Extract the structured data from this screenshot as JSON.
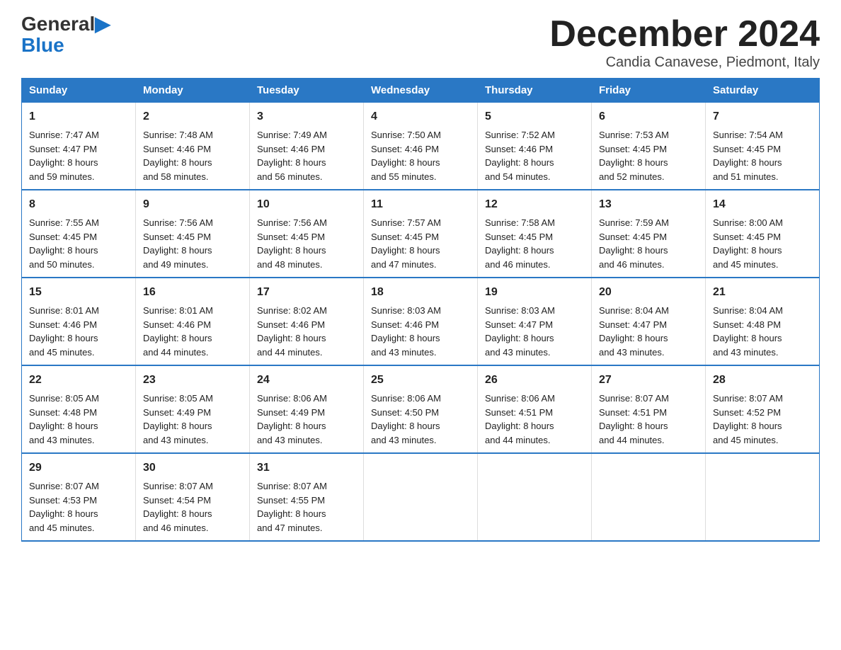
{
  "header": {
    "logo_general": "General",
    "logo_blue": "Blue",
    "month_title": "December 2024",
    "location": "Candia Canavese, Piedmont, Italy"
  },
  "weekdays": [
    "Sunday",
    "Monday",
    "Tuesday",
    "Wednesday",
    "Thursday",
    "Friday",
    "Saturday"
  ],
  "weeks": [
    [
      {
        "day": "1",
        "sunrise": "7:47 AM",
        "sunset": "4:47 PM",
        "daylight": "8 hours and 59 minutes."
      },
      {
        "day": "2",
        "sunrise": "7:48 AM",
        "sunset": "4:46 PM",
        "daylight": "8 hours and 58 minutes."
      },
      {
        "day": "3",
        "sunrise": "7:49 AM",
        "sunset": "4:46 PM",
        "daylight": "8 hours and 56 minutes."
      },
      {
        "day": "4",
        "sunrise": "7:50 AM",
        "sunset": "4:46 PM",
        "daylight": "8 hours and 55 minutes."
      },
      {
        "day": "5",
        "sunrise": "7:52 AM",
        "sunset": "4:46 PM",
        "daylight": "8 hours and 54 minutes."
      },
      {
        "day": "6",
        "sunrise": "7:53 AM",
        "sunset": "4:45 PM",
        "daylight": "8 hours and 52 minutes."
      },
      {
        "day": "7",
        "sunrise": "7:54 AM",
        "sunset": "4:45 PM",
        "daylight": "8 hours and 51 minutes."
      }
    ],
    [
      {
        "day": "8",
        "sunrise": "7:55 AM",
        "sunset": "4:45 PM",
        "daylight": "8 hours and 50 minutes."
      },
      {
        "day": "9",
        "sunrise": "7:56 AM",
        "sunset": "4:45 PM",
        "daylight": "8 hours and 49 minutes."
      },
      {
        "day": "10",
        "sunrise": "7:56 AM",
        "sunset": "4:45 PM",
        "daylight": "8 hours and 48 minutes."
      },
      {
        "day": "11",
        "sunrise": "7:57 AM",
        "sunset": "4:45 PM",
        "daylight": "8 hours and 47 minutes."
      },
      {
        "day": "12",
        "sunrise": "7:58 AM",
        "sunset": "4:45 PM",
        "daylight": "8 hours and 46 minutes."
      },
      {
        "day": "13",
        "sunrise": "7:59 AM",
        "sunset": "4:45 PM",
        "daylight": "8 hours and 46 minutes."
      },
      {
        "day": "14",
        "sunrise": "8:00 AM",
        "sunset": "4:45 PM",
        "daylight": "8 hours and 45 minutes."
      }
    ],
    [
      {
        "day": "15",
        "sunrise": "8:01 AM",
        "sunset": "4:46 PM",
        "daylight": "8 hours and 45 minutes."
      },
      {
        "day": "16",
        "sunrise": "8:01 AM",
        "sunset": "4:46 PM",
        "daylight": "8 hours and 44 minutes."
      },
      {
        "day": "17",
        "sunrise": "8:02 AM",
        "sunset": "4:46 PM",
        "daylight": "8 hours and 44 minutes."
      },
      {
        "day": "18",
        "sunrise": "8:03 AM",
        "sunset": "4:46 PM",
        "daylight": "8 hours and 43 minutes."
      },
      {
        "day": "19",
        "sunrise": "8:03 AM",
        "sunset": "4:47 PM",
        "daylight": "8 hours and 43 minutes."
      },
      {
        "day": "20",
        "sunrise": "8:04 AM",
        "sunset": "4:47 PM",
        "daylight": "8 hours and 43 minutes."
      },
      {
        "day": "21",
        "sunrise": "8:04 AM",
        "sunset": "4:48 PM",
        "daylight": "8 hours and 43 minutes."
      }
    ],
    [
      {
        "day": "22",
        "sunrise": "8:05 AM",
        "sunset": "4:48 PM",
        "daylight": "8 hours and 43 minutes."
      },
      {
        "day": "23",
        "sunrise": "8:05 AM",
        "sunset": "4:49 PM",
        "daylight": "8 hours and 43 minutes."
      },
      {
        "day": "24",
        "sunrise": "8:06 AM",
        "sunset": "4:49 PM",
        "daylight": "8 hours and 43 minutes."
      },
      {
        "day": "25",
        "sunrise": "8:06 AM",
        "sunset": "4:50 PM",
        "daylight": "8 hours and 43 minutes."
      },
      {
        "day": "26",
        "sunrise": "8:06 AM",
        "sunset": "4:51 PM",
        "daylight": "8 hours and 44 minutes."
      },
      {
        "day": "27",
        "sunrise": "8:07 AM",
        "sunset": "4:51 PM",
        "daylight": "8 hours and 44 minutes."
      },
      {
        "day": "28",
        "sunrise": "8:07 AM",
        "sunset": "4:52 PM",
        "daylight": "8 hours and 45 minutes."
      }
    ],
    [
      {
        "day": "29",
        "sunrise": "8:07 AM",
        "sunset": "4:53 PM",
        "daylight": "8 hours and 45 minutes."
      },
      {
        "day": "30",
        "sunrise": "8:07 AM",
        "sunset": "4:54 PM",
        "daylight": "8 hours and 46 minutes."
      },
      {
        "day": "31",
        "sunrise": "8:07 AM",
        "sunset": "4:55 PM",
        "daylight": "8 hours and 47 minutes."
      },
      {
        "day": "",
        "sunrise": "",
        "sunset": "",
        "daylight": ""
      },
      {
        "day": "",
        "sunrise": "",
        "sunset": "",
        "daylight": ""
      },
      {
        "day": "",
        "sunrise": "",
        "sunset": "",
        "daylight": ""
      },
      {
        "day": "",
        "sunrise": "",
        "sunset": "",
        "daylight": ""
      }
    ]
  ],
  "labels": {
    "sunrise_prefix": "Sunrise: ",
    "sunset_prefix": "Sunset: ",
    "daylight_prefix": "Daylight: "
  }
}
